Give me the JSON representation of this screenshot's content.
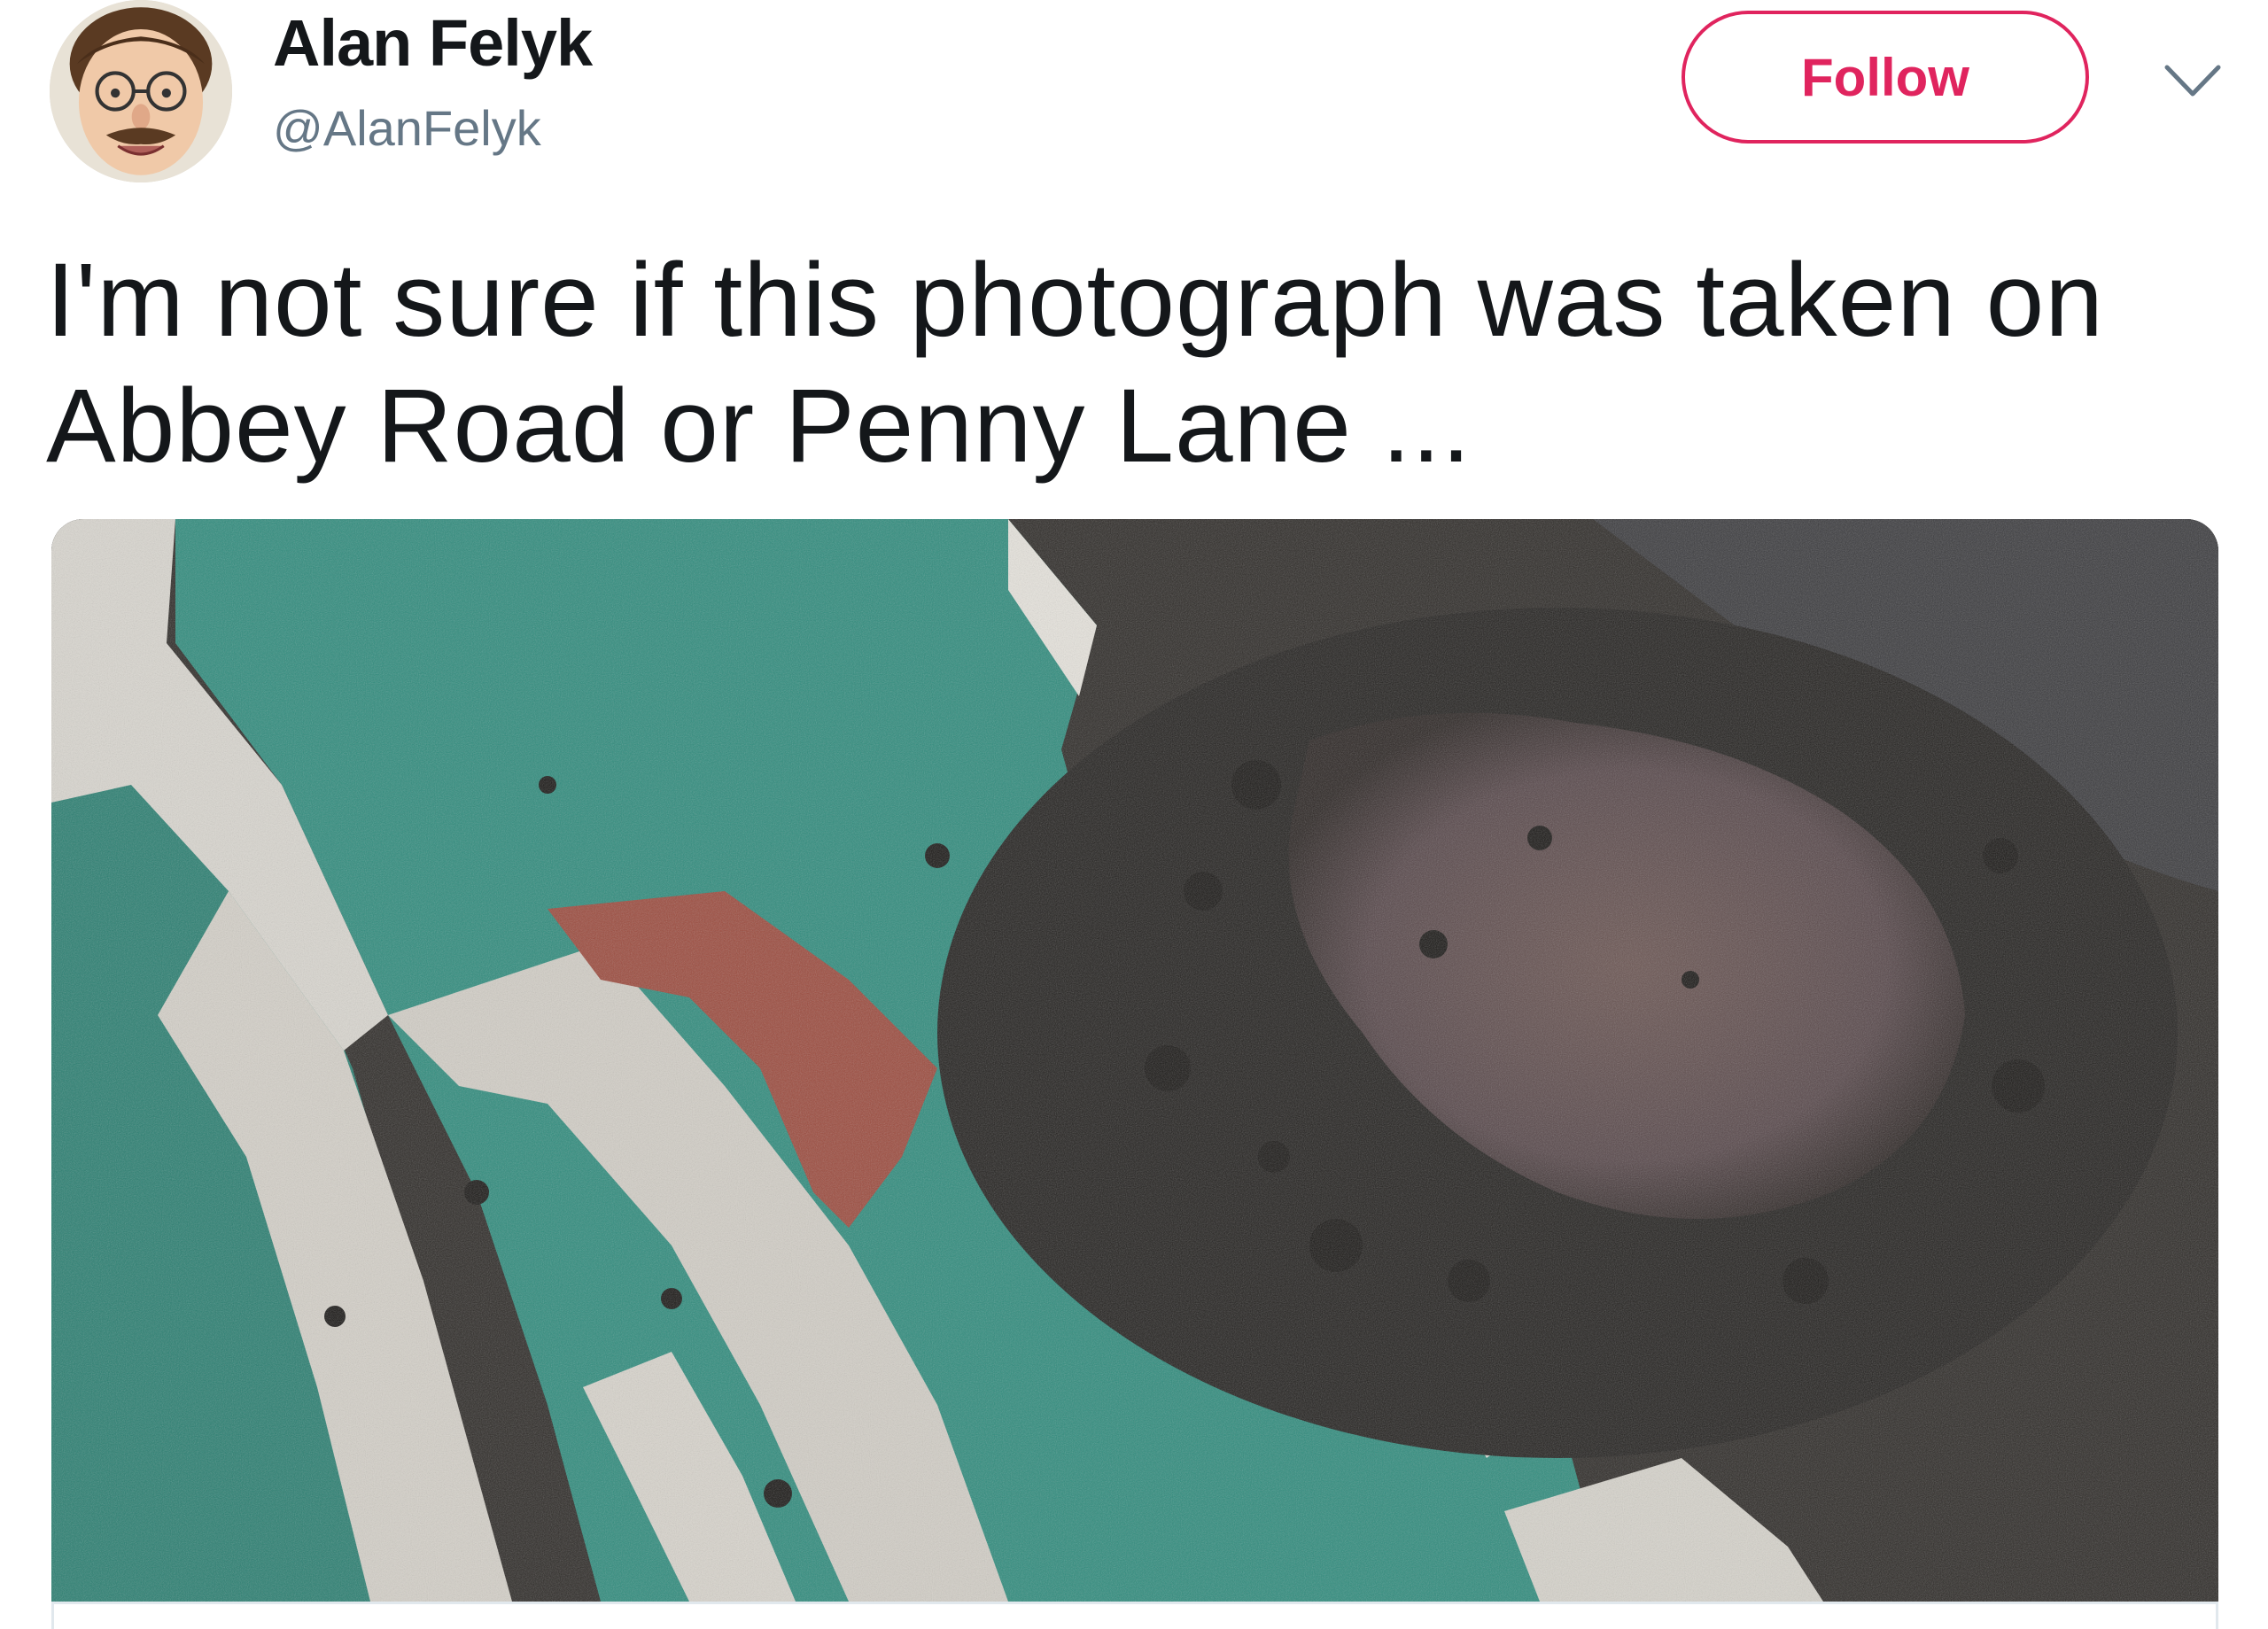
{
  "author": {
    "display_name": "Alan Felyk",
    "handle": "@AlanFelyk",
    "avatar_icon": "user-avatar-caricature"
  },
  "actions": {
    "follow_label": "Follow",
    "menu_icon": "chevron-down-icon"
  },
  "tweet": {
    "text": "I'm not sure if this photograph was taken on Abbey Road or Penny Lane ..."
  },
  "media": {
    "kind": "photo",
    "subject_icon": "pothole-crosswalk-photo"
  },
  "colors": {
    "follow_accent": "#e0245e",
    "text_primary": "#14171a",
    "text_secondary": "#657786",
    "card_border": "#e1e8ed"
  }
}
